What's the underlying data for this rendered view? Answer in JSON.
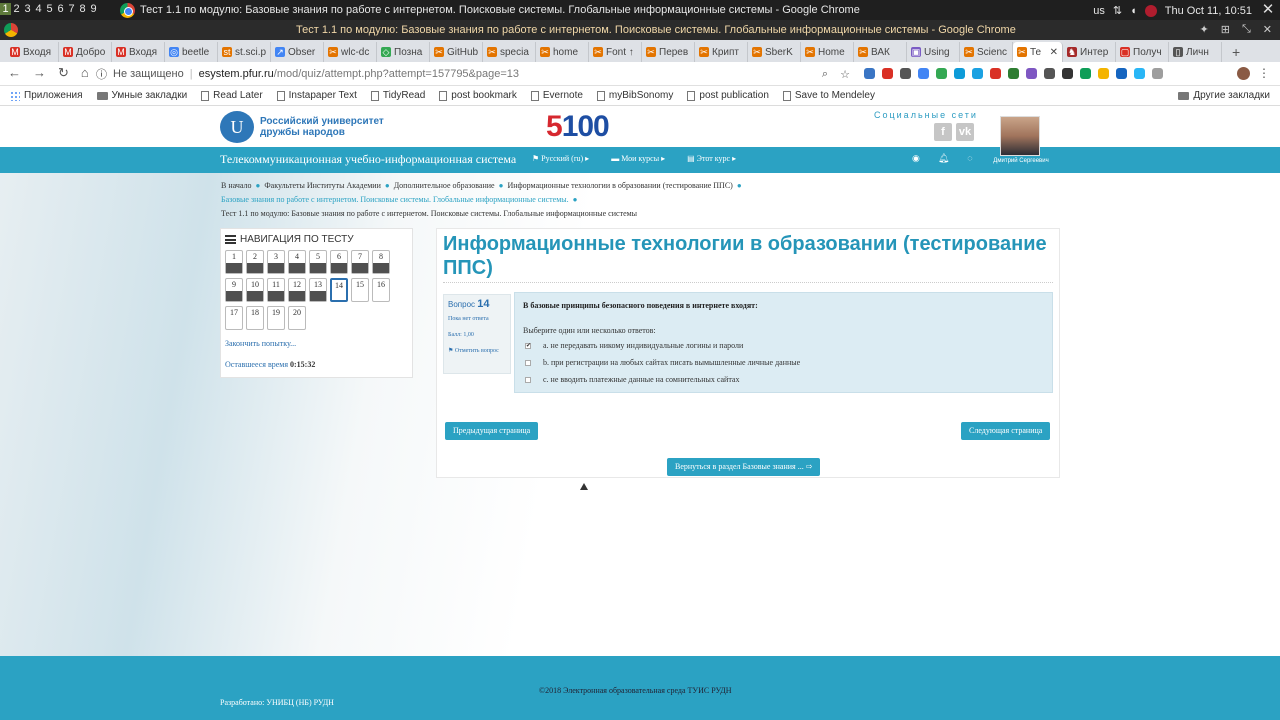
{
  "os_bar": {
    "workspaces": [
      "1",
      "2",
      "3",
      "4",
      "5",
      "6",
      "7",
      "8",
      "9"
    ],
    "window_title": "Тест 1.1 по модулю: Базовые знания по работе с интернетом. Поисковые системы. Глобальные информационные системы - Google Chrome",
    "keyboard_layout": "us",
    "datetime": "Thu Oct 11, 10:51"
  },
  "chrome_title": "Тест 1.1 по модулю: Базовые знания по работе с интернетом. Поисковые системы. Глобальные информационные системы - Google Chrome",
  "tabs": [
    {
      "label": "Входя",
      "color": "#d93025",
      "glyph": "M"
    },
    {
      "label": "Добро",
      "color": "#d93025",
      "glyph": "M"
    },
    {
      "label": "Входя",
      "color": "#d93025",
      "glyph": "M"
    },
    {
      "label": "beetle",
      "color": "#4285f4",
      "glyph": "◎"
    },
    {
      "label": "st.sci.p",
      "color": "#e37400",
      "glyph": "st"
    },
    {
      "label": "Obser",
      "color": "#4285f4",
      "glyph": "↗"
    },
    {
      "label": "wlc-dc",
      "color": "#e37400",
      "glyph": "✂"
    },
    {
      "label": "Позна",
      "color": "#34a853",
      "glyph": "◇"
    },
    {
      "label": "GitHub",
      "color": "#e37400",
      "glyph": "✂"
    },
    {
      "label": "specia",
      "color": "#e37400",
      "glyph": "✂"
    },
    {
      "label": "home",
      "color": "#e37400",
      "glyph": "✂"
    },
    {
      "label": "Font ↑",
      "color": "#e37400",
      "glyph": "✂"
    },
    {
      "label": "Перев",
      "color": "#e37400",
      "glyph": "✂"
    },
    {
      "label": "Крипт",
      "color": "#e37400",
      "glyph": "✂"
    },
    {
      "label": "SberK",
      "color": "#e37400",
      "glyph": "✂"
    },
    {
      "label": "Home",
      "color": "#e37400",
      "glyph": "✂"
    },
    {
      "label": "ВАК",
      "color": "#e37400",
      "glyph": "✂"
    },
    {
      "label": "Using",
      "color": "#7a5cc4",
      "glyph": "▣"
    },
    {
      "label": "Scienc",
      "color": "#e37400",
      "glyph": "✂"
    },
    {
      "label": "Те",
      "color": "#e37400",
      "glyph": "✂",
      "active": true
    },
    {
      "label": "Интер",
      "color": "#a52a2a",
      "glyph": "♞"
    },
    {
      "label": "Получ",
      "color": "#d93025",
      "glyph": "▢"
    },
    {
      "label": "Личн",
      "color": "#555555",
      "glyph": "▯"
    }
  ],
  "address": {
    "insecure_label": "Не защищено",
    "host": "esystem.pfur.ru",
    "path": "/mod/quiz/attempt.php?attempt=157795&page=13"
  },
  "bookmarks": [
    {
      "label": "Приложения",
      "icon": "apps-icon"
    },
    {
      "label": "Умные закладки",
      "icon": "folder-icon"
    },
    {
      "label": "Read Later",
      "icon": "page-icon"
    },
    {
      "label": "Instapaper Text",
      "icon": "page-icon"
    },
    {
      "label": "TidyRead",
      "icon": "page-icon"
    },
    {
      "label": "post bookmark",
      "icon": "page-icon"
    },
    {
      "label": "Evernote",
      "icon": "page-icon"
    },
    {
      "label": "myBibSonomy",
      "icon": "page-icon"
    },
    {
      "label": "post publication",
      "icon": "page-icon"
    },
    {
      "label": "Save to Mendeley",
      "icon": "page-icon"
    }
  ],
  "bookmarks_other": "Другие закладки",
  "site": {
    "university_name_line1": "Российский университет",
    "university_name_line2": "дружбы народов",
    "logo_5100_five": "5",
    "logo_5100_rest": "100",
    "social_label": "Социальные сети",
    "social_icons": [
      "f",
      "vk"
    ],
    "user_name": "Дмитрий Сергеевич",
    "brand": "Телекоммуникационная учебно-информационная система",
    "menu": [
      {
        "label": "Русский (ru)",
        "icon": "flag-icon"
      },
      {
        "label": "Мои курсы",
        "icon": "briefcase-icon"
      },
      {
        "label": "Этот курс",
        "icon": "book-icon"
      }
    ]
  },
  "breadcrumb": {
    "items": [
      "В начало",
      "Факультеты Институты Академии",
      "Дополнительное образование",
      "Информационные технологии в образовании (тестирование ППС)"
    ],
    "line2": "Базовые знания по работе с интернетом. Поисковые системы. Глобальные информационные системы.",
    "line3": "Тест 1.1 по модулю: Базовые знания по работе с интернетом. Поисковые системы. Глобальные информационные системы"
  },
  "quiz_nav": {
    "title": "НАВИГАЦИЯ ПО ТЕСТУ",
    "questions": [
      {
        "n": "1",
        "answered": true
      },
      {
        "n": "2",
        "answered": true
      },
      {
        "n": "3",
        "answered": true
      },
      {
        "n": "4",
        "answered": true
      },
      {
        "n": "5",
        "answered": true
      },
      {
        "n": "6",
        "answered": true
      },
      {
        "n": "7",
        "answered": true
      },
      {
        "n": "8",
        "answered": true
      },
      {
        "n": "9",
        "answered": true
      },
      {
        "n": "10",
        "answered": true
      },
      {
        "n": "11",
        "answered": true
      },
      {
        "n": "12",
        "answered": true
      },
      {
        "n": "13",
        "answered": true
      },
      {
        "n": "14",
        "current": true
      },
      {
        "n": "15"
      },
      {
        "n": "16"
      },
      {
        "n": "17"
      },
      {
        "n": "18"
      },
      {
        "n": "19"
      },
      {
        "n": "20"
      }
    ],
    "finish_label": "Закончить попытку...",
    "timer_label": "Оставшееся время",
    "timer_value": "0:15:32"
  },
  "main": {
    "course_title": "Информационные технологии в образовании (тестирование ППС)",
    "question": {
      "label": "Вопрос",
      "number": "14",
      "state": "Пока нет ответа",
      "grade": "Балл: 1,00",
      "flag_label": "Отметить вопрос",
      "text": "В базовые принципы безопасного поведения в интернете входят:",
      "prompt": "Выберите один или несколько ответов:",
      "answers": [
        {
          "label": "a. не передавать никому индивидуальные логины и пароли",
          "checked": true
        },
        {
          "label": "b. при регистрации на любых сайтах писать вымышленные личные данные",
          "checked": false
        },
        {
          "label": "c. не вводить платежные данные на сомнительных сайтах",
          "checked": false
        }
      ]
    },
    "prev_button": "Предыдущая страница",
    "next_button": "Следующая страница",
    "return_button": "Вернуться в раздел Базовые знания ... ⇨"
  },
  "footer": {
    "copyright": "©2018 Электронная образовательная среда ТУИС РУДН",
    "developer": "Разработано: УНИБЦ (НБ) РУДН"
  },
  "colors": {
    "accent": "#2ba2c3",
    "title": "#2595b8",
    "link": "#2b6fae",
    "question_bg": "#dcecf3"
  }
}
